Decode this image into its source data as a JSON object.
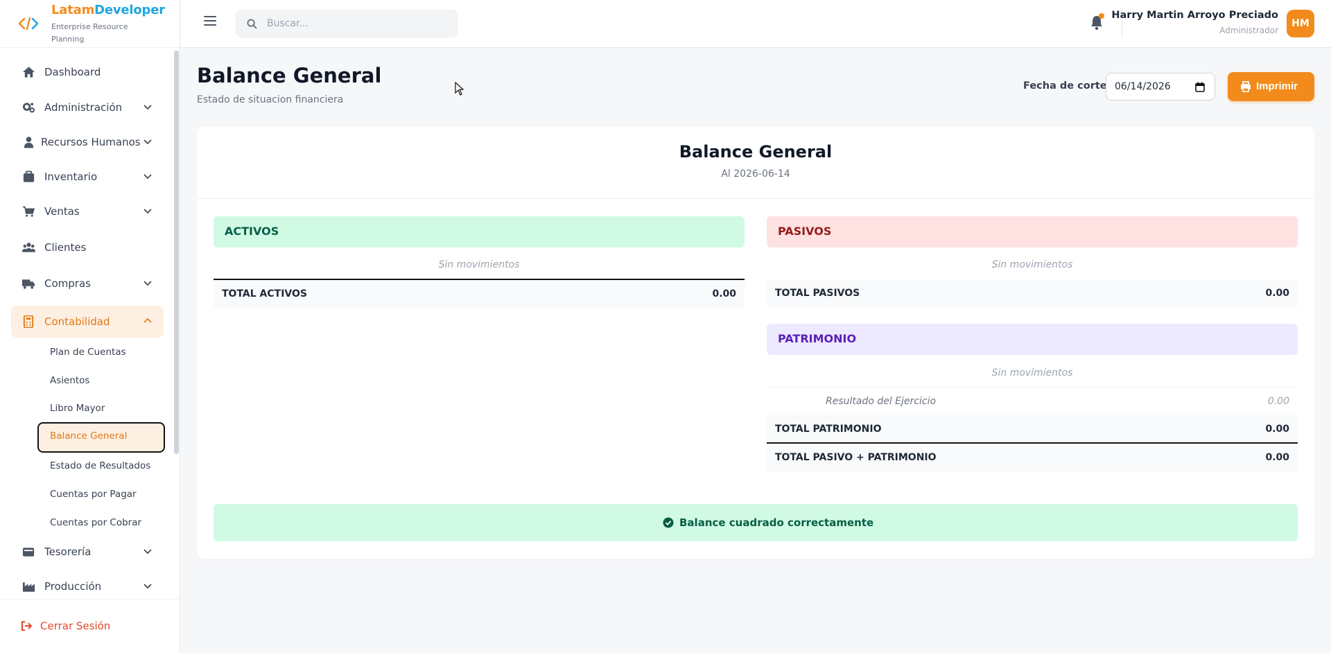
{
  "brand": {
    "name_part1": "Latam",
    "name_part2": "Developer",
    "subtitle": "Enterprise Resource Planning"
  },
  "sidebar": {
    "items": [
      {
        "label": "Dashboard",
        "icon": "home-icon"
      },
      {
        "label": "Administración",
        "icon": "gears-icon"
      },
      {
        "label": "Recursos Humanos",
        "icon": "user-icon"
      },
      {
        "label": "Inventario",
        "icon": "box-icon"
      },
      {
        "label": "Ventas",
        "icon": "cart-icon"
      },
      {
        "label": "Clientes",
        "icon": "users-icon"
      },
      {
        "label": "Compras",
        "icon": "truck-icon"
      },
      {
        "label": "Contabilidad",
        "icon": "calculator-icon",
        "active": true
      },
      {
        "label": "Tesorería",
        "icon": "wallet-icon"
      },
      {
        "label": "Producción",
        "icon": "factory-icon"
      }
    ],
    "subitems": [
      "Plan de Cuentas",
      "Asientos",
      "Libro Mayor",
      "Balance General",
      "Estado de Resultados",
      "Cuentas por Pagar",
      "Cuentas por Cobrar"
    ],
    "active_subitem": "Balance General",
    "logout_label": "Cerrar Sesión"
  },
  "topbar": {
    "search_placeholder": "Buscar...",
    "user_name": "Harry Martin Arroyo Preciado",
    "user_role": "Administrador",
    "avatar_initials": "HM"
  },
  "page": {
    "title": "Balance General",
    "subtitle": "Estado de situacion financiera",
    "date_label": "Fecha de corte:",
    "date_value": "06/14/2026",
    "print_label": "Imprimir"
  },
  "report": {
    "title": "Balance General",
    "subtitle": "Al 2026-06-14",
    "activos": {
      "header": "ACTIVOS",
      "empty": "Sin movimientos",
      "total_label": "TOTAL ACTIVOS",
      "total_value": "0.00"
    },
    "pasivos": {
      "header": "PASIVOS",
      "empty": "Sin movimientos",
      "total_label": "TOTAL PASIVOS",
      "total_value": "0.00"
    },
    "patrimonio": {
      "header": "PATRIMONIO",
      "empty": "Sin movimientos",
      "item_label": "Resultado del Ejercicio",
      "item_value": "0.00",
      "total_label": "TOTAL PATRIMONIO",
      "total_value": "0.00"
    },
    "grand_total_label": "TOTAL PASIVO + PATRIMONIO",
    "grand_total_value": "0.00",
    "status_message": "Balance cuadrado correctamente"
  },
  "colors": {
    "accent": "#f28b1c",
    "activos_bg": "#d1fae5",
    "activos_text": "#065f46",
    "pasivos_bg": "#fee2e2",
    "pasivos_text": "#991b1b",
    "patrimonio_bg": "#ede9fe",
    "patrimonio_text": "#5b21b6"
  }
}
